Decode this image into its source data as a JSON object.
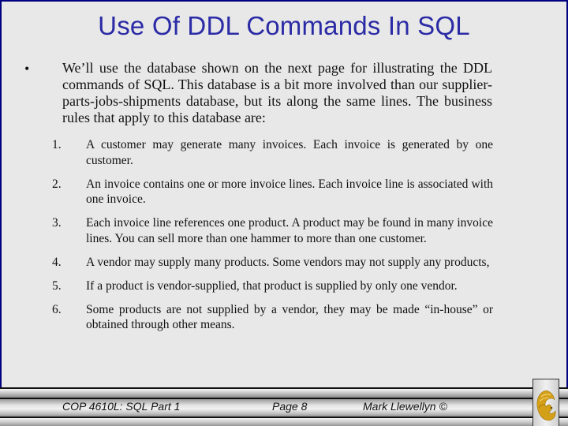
{
  "slide": {
    "title": "Use Of DDL Commands In SQL",
    "bullet_symbol": "•",
    "intro": "We’ll use the database shown on the next page for illustrating the DDL commands of SQL.  This database is a bit more involved than our supplier-parts-jobs-shipments database, but its along the same lines.  The business rules that apply to this database are:",
    "rules": [
      {
        "number": "1.",
        "text": "A customer may generate many invoices. Each invoice is generated by one customer."
      },
      {
        "number": "2.",
        "text": "An invoice contains one or more invoice lines.  Each invoice line is associated with one invoice."
      },
      {
        "number": "3.",
        "text": "Each invoice line references one product.  A product may be found in many invoice lines.  You can sell more than one hammer to more than one customer."
      },
      {
        "number": "4.",
        "text": "A vendor may supply many products.  Some vendors may not supply any products,"
      },
      {
        "number": "5.",
        "text": "If a product is vendor-supplied, that product is supplied by only one vendor."
      },
      {
        "number": "6.",
        "text": "Some products are not supplied by a vendor, they may be made “in-house” or obtained through other means."
      }
    ]
  },
  "footer": {
    "course": "COP 4610L: SQL Part 1",
    "page": "Page 8",
    "author": "Mark Llewellyn ©",
    "logo_icon": "pegasus-logo-icon"
  },
  "colors": {
    "title": "#2b2ba6",
    "frame": "#000080",
    "background": "#e8e8e8",
    "logo_gold": "#d4a017"
  }
}
